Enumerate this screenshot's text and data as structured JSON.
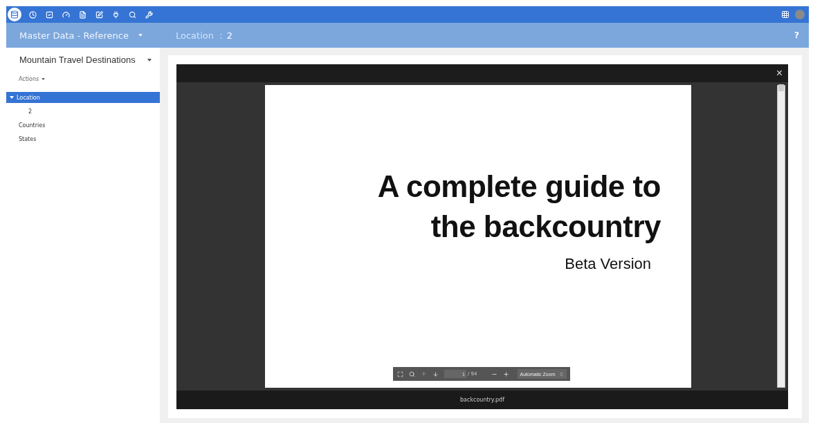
{
  "toolbar": [
    {
      "kind": "database",
      "selected": true
    },
    {
      "kind": "clock",
      "selected": false
    },
    {
      "kind": "check",
      "selected": false
    },
    {
      "kind": "gauge",
      "selected": false
    },
    {
      "kind": "form",
      "selected": false
    },
    {
      "kind": "edit",
      "selected": false
    },
    {
      "kind": "plug",
      "selected": false
    },
    {
      "kind": "search",
      "selected": false
    },
    {
      "kind": "wrench",
      "selected": false
    }
  ],
  "subheader": {
    "module": "Master Data - Reference",
    "context_label": "Location",
    "separator": ":",
    "context_value": "2",
    "help": "?"
  },
  "sidebar": {
    "title": "Mountain Travel Destinations",
    "actions": "Actions",
    "tree": [
      {
        "label": "Location",
        "selected": true,
        "expanded": true,
        "children": [
          {
            "label": "2",
            "selected": false
          }
        ]
      },
      {
        "label": "Countries",
        "selected": false
      },
      {
        "label": "States",
        "selected": false
      }
    ]
  },
  "viewer": {
    "close": "×",
    "headline": "A complete guide to the backcountry",
    "subtitle": "Beta Version",
    "page": "1",
    "page_count": "/ 94",
    "zoom": "Automatic Zoom",
    "filename": "backcountry.pdf"
  }
}
